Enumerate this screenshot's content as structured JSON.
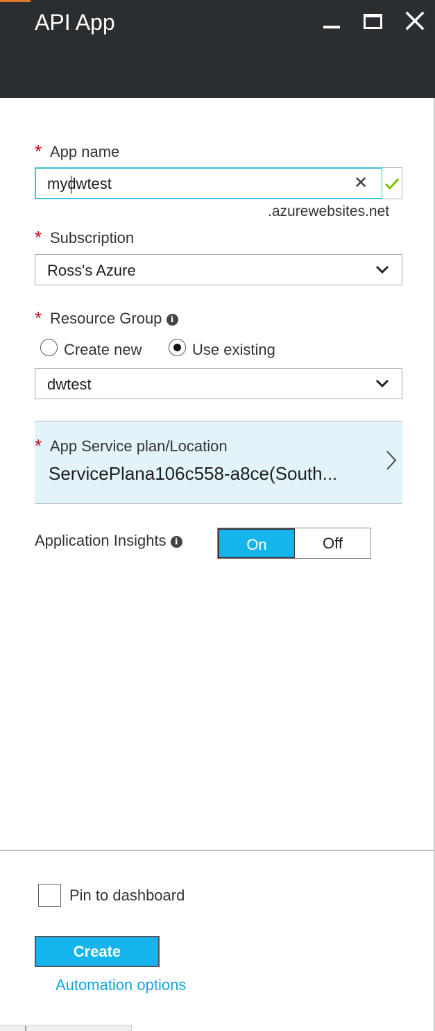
{
  "window": {
    "title": "API App",
    "controls": [
      "minimize-icon",
      "maximize-icon",
      "close-icon"
    ]
  },
  "form": {
    "required_marker": "*",
    "app_name": {
      "label": "App name",
      "value": "mydwtest",
      "suffix": ".azurewebsites.net",
      "clear_glyph": "✕",
      "valid_icon": "checkmark-icon"
    },
    "subscription": {
      "label": "Subscription",
      "value": "Ross's Azure"
    },
    "resource_group": {
      "label": "Resource Group",
      "info_glyph": "i",
      "options": [
        {
          "label": "Create new",
          "checked": false
        },
        {
          "label": "Use existing",
          "checked": true
        }
      ],
      "value": "dwtest"
    },
    "app_service_plan": {
      "label": "App Service plan/Location",
      "value": "ServicePlana106c558-a8ce(South..."
    },
    "app_insights": {
      "label": "Application Insights",
      "info_glyph": "i",
      "on_label": "On",
      "off_label": "Off",
      "selected": "On"
    }
  },
  "footer": {
    "pin_label": "Pin to dashboard",
    "pin_checked": false,
    "create_label": "Create",
    "automation_label": "Automation options"
  },
  "colors": {
    "header_bg": "#2b2e31",
    "accent": "#14b4ec",
    "required": "#d0021b",
    "valid": "#7fba00",
    "link": "#14a4dc",
    "plan_bg": "#e3f3fa"
  }
}
